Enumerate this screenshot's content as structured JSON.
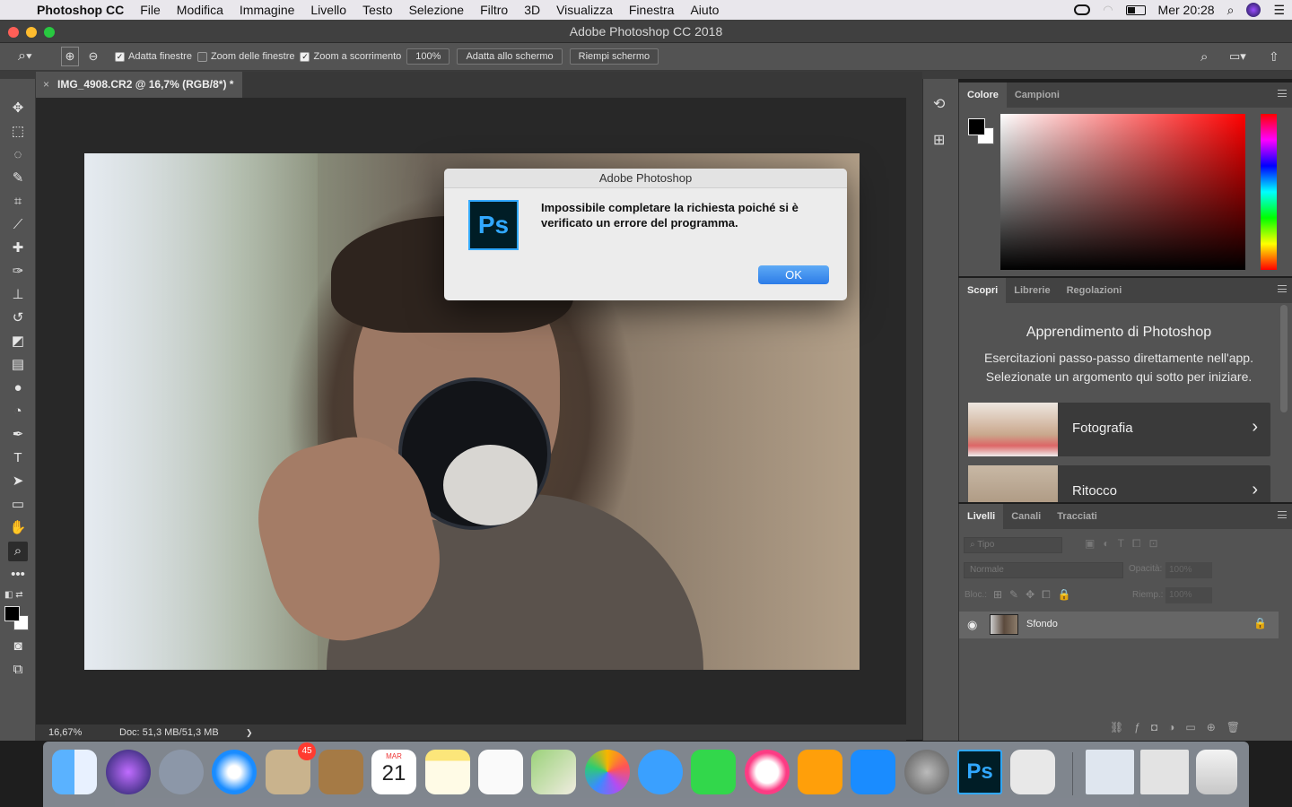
{
  "menubar": {
    "app": "Photoshop CC",
    "items": [
      "File",
      "Modifica",
      "Immagine",
      "Livello",
      "Testo",
      "Selezione",
      "Filtro",
      "3D",
      "Visualizza",
      "Finestra",
      "Aiuto"
    ],
    "clock": "Mer 20:28"
  },
  "window": {
    "title": "Adobe Photoshop CC 2018"
  },
  "options": {
    "check1": "Adatta finestre",
    "check2": "Zoom delle finestre",
    "check3": "Zoom a scorrimento",
    "zoom_value": "100%",
    "btn_fit": "Adatta allo schermo",
    "btn_fill": "Riempi schermo"
  },
  "document": {
    "tab_title": "IMG_4908.CR2 @ 16,7% (RGB/8*) *",
    "close": "×"
  },
  "status": {
    "zoom": "16,67%",
    "doc": "Doc: 51,3 MB/51,3 MB",
    "arrow": "❯"
  },
  "color_panel": {
    "tabs": [
      "Colore",
      "Campioni"
    ]
  },
  "learn_panel": {
    "tabs": [
      "Scopri",
      "Librerie",
      "Regolazioni"
    ],
    "heading": "Apprendimento di Photoshop",
    "text1": "Esercitazioni passo-passo direttamente nell'app.",
    "text2": "Selezionate un argomento qui sotto per iniziare.",
    "items": [
      {
        "label": "Fotografia"
      },
      {
        "label": "Ritocco"
      }
    ]
  },
  "layers_panel": {
    "tabs": [
      "Livelli",
      "Canali",
      "Tracciati"
    ],
    "filter_placeholder": "Tipo",
    "blend_mode": "Normale",
    "opacity_label": "Opacità:",
    "opacity_value": "100%",
    "lock_label": "Bloc.:",
    "fill_label": "Riemp.:",
    "fill_value": "100%",
    "layer_name": "Sfondo"
  },
  "dialog": {
    "title": "Adobe Photoshop",
    "message": "Impossibile completare la richiesta poiché si è verificato un errore del programma.",
    "ok": "OK",
    "icon_text": "Ps"
  },
  "dock": {
    "mail_badge": "45",
    "calendar_month": "MAR",
    "calendar_day": "21",
    "ps_text": "Ps"
  },
  "colors": {
    "accent": "#2c7ce8",
    "ps_blue": "#31a8ff",
    "ui_panel": "#535353"
  }
}
